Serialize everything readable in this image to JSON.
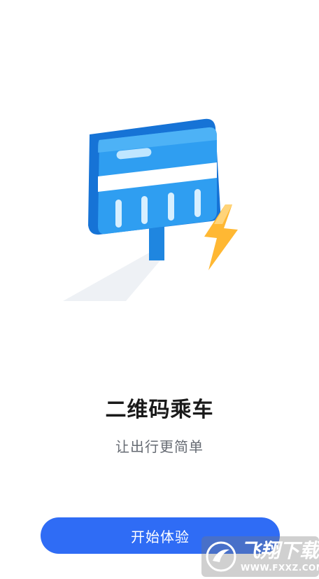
{
  "hero": {
    "illustration": "qr-reader-with-lightning-illustration",
    "colors": {
      "device_blue": "#2f9ef1",
      "device_light": "#66c2ff",
      "lightning": "#ffb833"
    }
  },
  "onboarding": {
    "title": "二维码乘车",
    "subtitle": "让出行更简单",
    "cta_label": "开始体验"
  },
  "watermark": {
    "brand": "飞翔下载",
    "url": "WWW.FXXZ.COM"
  },
  "theme": {
    "primary": "#2f6cf5"
  }
}
